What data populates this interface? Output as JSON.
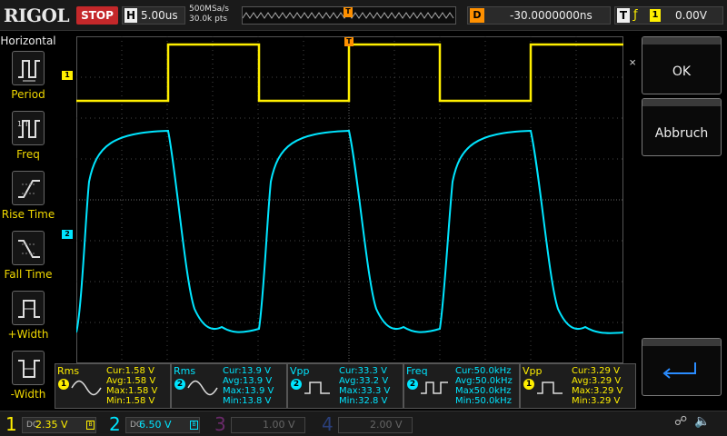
{
  "top": {
    "logo": "RIGOL",
    "run_status": "STOP",
    "h_label": "H",
    "timebase": "5.00us",
    "sample_rate": "500MSa/s",
    "memory_depth": "30.0k pts",
    "trigger_pos_marker": "T",
    "d_label": "D",
    "delay": "-30.0000000ns",
    "t_label": "T",
    "trigger_edge": "rising-edge-icon",
    "trigger_source": "1",
    "trigger_level": "0.00V"
  },
  "left_panel": {
    "title": "Horizontal",
    "items": [
      {
        "label": "Period",
        "icon": "period-icon"
      },
      {
        "label": "Freq",
        "icon": "freq-icon"
      },
      {
        "label": "Rise Time",
        "icon": "rise-time-icon"
      },
      {
        "label": "Fall Time",
        "icon": "fall-time-icon"
      },
      {
        "label": "+Width",
        "icon": "pos-width-icon"
      },
      {
        "label": "-Width",
        "icon": "neg-width-icon"
      }
    ]
  },
  "right_panel": {
    "close_glyph": "OK",
    "ok_label": "OK",
    "cancel_label": "Abbruch",
    "enter_icon": "enter-icon"
  },
  "channel_markers": {
    "ch1": "1",
    "ch2": "2",
    "trigger": "T"
  },
  "measurements": [
    {
      "name": "Rms",
      "ch": "1",
      "cur": "Cur:1.58 V",
      "avg": "Avg:1.58 V",
      "max": "Max:1.58 V",
      "min": "Min:1.58 V",
      "color": "#ffef00"
    },
    {
      "name": "Rms",
      "ch": "2",
      "cur": "Cur:13.9 V",
      "avg": "Avg:13.9 V",
      "max": "Max:13.9 V",
      "min": "Min:13.8 V",
      "color": "#00e5ff"
    },
    {
      "name": "Vpp",
      "ch": "2",
      "cur": "Cur:33.3 V",
      "avg": "Avg:33.2 V",
      "max": "Max:33.3 V",
      "min": "Min:32.8 V",
      "color": "#00e5ff"
    },
    {
      "name": "Freq",
      "ch": "2",
      "cur": "Cur:50.0kHz",
      "avg": "Avg:50.0kHz",
      "max": "Max50.0kHz",
      "min": "Min:50.0kHz",
      "color": "#00e5ff"
    },
    {
      "name": "Vpp",
      "ch": "1",
      "cur": "Cur:3.29 V",
      "avg": "Avg:3.29 V",
      "max": "Max:3.29 V",
      "min": "Min:3.29 V",
      "color": "#ffef00"
    }
  ],
  "channels": [
    {
      "num": "1",
      "scale": "2.35 V",
      "coupling": "DC",
      "color": "#ffef00",
      "active": true
    },
    {
      "num": "2",
      "scale": "6.50 V",
      "coupling": "DC",
      "color": "#00e5ff",
      "active": true
    },
    {
      "num": "3",
      "scale": "1.00 V",
      "coupling": "",
      "color": "#c030c0",
      "active": false
    },
    {
      "num": "4",
      "scale": "2.00 V",
      "coupling": "",
      "color": "#3a6be0",
      "active": false
    }
  ],
  "colors": {
    "ch1": "#ffef00",
    "ch2": "#00e5ff",
    "trigger": "#ff9000",
    "stop": "#c4282a"
  }
}
